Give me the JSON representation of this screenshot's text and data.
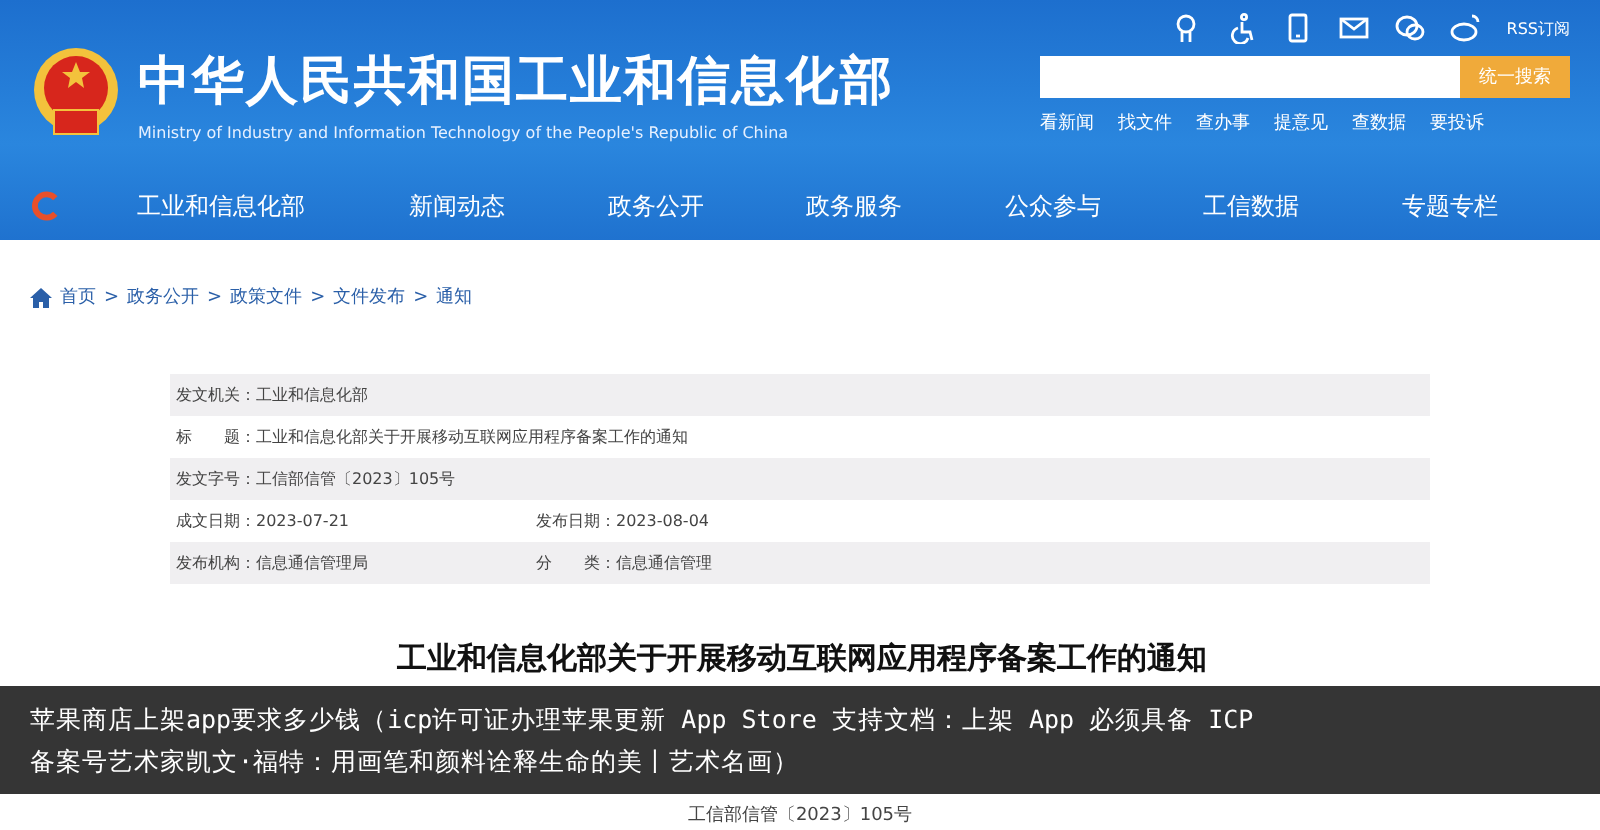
{
  "header": {
    "title": "中华人民共和国工业和信息化部",
    "subtitle": "Ministry of Industry and Information Technology of the People's Republic of China",
    "rss": "RSS订阅",
    "search": {
      "button": "统一搜索"
    },
    "quick_links": [
      "看新闻",
      "找文件",
      "查办事",
      "提意见",
      "查数据",
      "要投诉"
    ]
  },
  "nav": [
    "工业和信息化部",
    "新闻动态",
    "政务公开",
    "政务服务",
    "公众参与",
    "工信数据",
    "专题专栏"
  ],
  "breadcrumb": [
    "首页",
    "政务公开",
    "政策文件",
    "文件发布",
    "通知"
  ],
  "breadcrumb_separator": ">",
  "info_rows": [
    {
      "cells": [
        {
          "label": "发文机关：",
          "value": "工业和信息化部"
        }
      ]
    },
    {
      "cells": [
        {
          "label": "标　　题：",
          "value": "工业和信息化部关于开展移动互联网应用程序备案工作的通知"
        }
      ]
    },
    {
      "cells": [
        {
          "label": "发文字号：",
          "value": "工信部信管〔2023〕105号"
        }
      ]
    },
    {
      "cells": [
        {
          "label": "成文日期：",
          "value": "2023-07-21"
        },
        {
          "label": "发布日期：",
          "value": "2023-08-04"
        }
      ]
    },
    {
      "cells": [
        {
          "label": "发布机构：",
          "value": "信息通信管理局"
        },
        {
          "label": "分　　类：",
          "value": "信息通信管理"
        }
      ]
    }
  ],
  "document": {
    "title": "工业和信息化部关于开展移动互联网应用程序备案工作的通知",
    "number": "工信部信管〔2023〕105号"
  },
  "caption": "苹果商店上架app要求多少钱（icp许可证办理苹果更新 App Store 支持文档：上架 App 必须具备 ICP 备案号艺术家凯文·福特：用画笔和颜料诠释生命的美丨艺术名画）"
}
